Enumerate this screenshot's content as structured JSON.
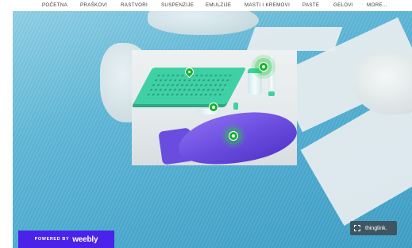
{
  "nav": {
    "items": [
      {
        "label": "POČETNA"
      },
      {
        "label": "PRAŠKOVI"
      },
      {
        "label": "RASTVORI"
      },
      {
        "label": "SUSPENZIJE"
      },
      {
        "label": "EMULZIJE"
      },
      {
        "label": "MASTI I KREMOVI"
      },
      {
        "label": "PASTE"
      },
      {
        "label": "GELOVI"
      },
      {
        "label": "MORE..."
      }
    ]
  },
  "thinglink": {
    "badge_label": "thinglink.",
    "hotspot_count": 4
  },
  "footer": {
    "powered_by": "POWERED BY",
    "brand": "weebly"
  },
  "colors": {
    "hotspot": "#17b32e",
    "weebly_brand": "#4a22ea",
    "tray": "#3fd1a5",
    "glove": "#6b4ee0"
  },
  "icons": [
    "location-pin-icon",
    "hotspot-icon",
    "fullscreen-icon"
  ]
}
